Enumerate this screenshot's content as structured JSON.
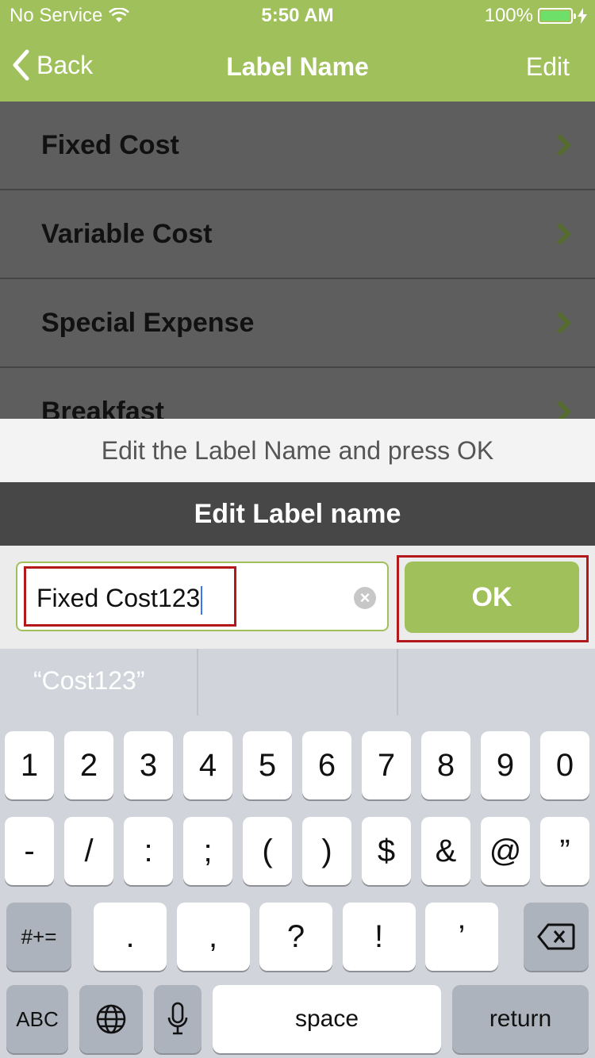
{
  "status_bar": {
    "carrier": "No Service",
    "time": "5:50 AM",
    "battery": "100%",
    "battery_level": 1.0
  },
  "nav": {
    "back_label": "Back",
    "title": "Label Name",
    "edit_label": "Edit"
  },
  "list": {
    "items": [
      {
        "label": "Fixed Cost"
      },
      {
        "label": "Variable Cost"
      },
      {
        "label": "Special Expense"
      },
      {
        "label": "Breakfast"
      }
    ]
  },
  "modal": {
    "hint": "Edit the Label Name and press OK",
    "header": "Edit Label name",
    "field_value": "Fixed Cost123",
    "ok_label": "OK"
  },
  "keyboard": {
    "suggestion": "“Cost123”",
    "row1": [
      "1",
      "2",
      "3",
      "4",
      "5",
      "6",
      "7",
      "8",
      "9",
      "0"
    ],
    "row2": [
      "-",
      "/",
      ":",
      ";",
      "(",
      ")",
      "$",
      "&",
      "@",
      "”"
    ],
    "row3_mode": "#+=",
    "row3": [
      ".",
      ",",
      "?",
      "!",
      "’"
    ],
    "abc": "ABC",
    "space": "space",
    "return": "return"
  },
  "colors": {
    "brand": "#9fc05a",
    "highlight": "#b3191b"
  }
}
